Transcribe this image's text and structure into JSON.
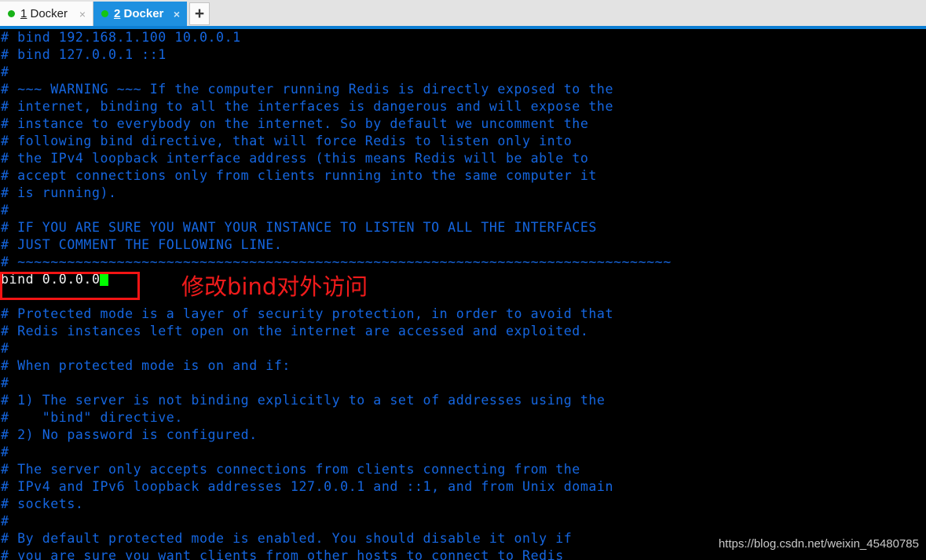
{
  "window": {
    "accent_blue": "#0d7fd4",
    "tabbar_bg": "#e3e3e3"
  },
  "tabs": {
    "items": [
      {
        "number": "1",
        "name": " Docker",
        "status_dot": "green-dot-icon",
        "close": "×",
        "active": false
      },
      {
        "number": "2",
        "name": " Docker",
        "status_dot": "green-dot-icon",
        "close": "×",
        "active": true
      }
    ],
    "add_label": "+"
  },
  "terminal": {
    "bg": "#000000",
    "comment_color": "#1566e0",
    "text_color": "#f2f2f2",
    "cursor_color": "#00ff00",
    "lines": [
      "# bind 192.168.1.100 10.0.0.1",
      "# bind 127.0.0.1 ::1",
      "#",
      "# ~~~ WARNING ~~~ If the computer running Redis is directly exposed to the",
      "# internet, binding to all the interfaces is dangerous and will expose the",
      "# instance to everybody on the internet. So by default we uncomment the",
      "# following bind directive, that will force Redis to listen only into",
      "# the IPv4 loopback interface address (this means Redis will be able to",
      "# accept connections only from clients running into the same computer it",
      "# is running).",
      "#",
      "# IF YOU ARE SURE YOU WANT YOUR INSTANCE TO LISTEN TO ALL THE INTERFACES",
      "# JUST COMMENT THE FOLLOWING LINE.",
      "# ~~~~~~~~~~~~~~~~~~~~~~~~~~~~~~~~~~~~~~~~~~~~~~~~~~~~~~~~~~~~~~~~~~~~~~~~~~~~~~~"
    ],
    "edited_line": "bind 0.0.0.0",
    "lines_after": [
      "",
      "# Protected mode is a layer of security protection, in order to avoid that",
      "# Redis instances left open on the internet are accessed and exploited.",
      "#",
      "# When protected mode is on and if:",
      "#",
      "# 1) The server is not binding explicitly to a set of addresses using the",
      "#    \"bind\" directive.",
      "# 2) No password is configured.",
      "#",
      "# The server only accepts connections from clients connecting from the",
      "# IPv4 and IPv6 loopback addresses 127.0.0.1 and ::1, and from Unix domain",
      "# sockets.",
      "#",
      "# By default protected mode is enabled. You should disable it only if",
      "# you are sure you want clients from other hosts to connect to Redis"
    ]
  },
  "annotations": {
    "note_text": "修改bind对外访问",
    "note_color": "#f01b1b",
    "box_color": "#f21414"
  },
  "watermark": {
    "text": "https://blog.csdn.net/weixin_45480785"
  }
}
